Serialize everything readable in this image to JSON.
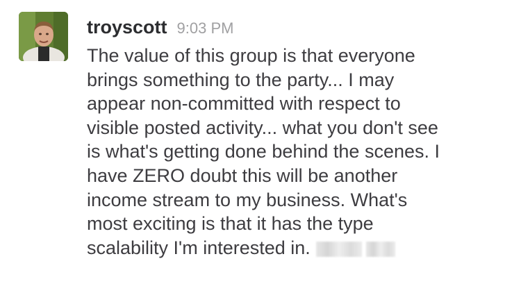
{
  "message": {
    "username": "troyscott",
    "timestamp": "9:03 PM",
    "lines": [
      "The value of this group is that everyone",
      "brings something to the party... I may",
      "appear non-committed with respect to",
      "visible posted activity... what you don't see",
      "is what's getting done behind the scenes. I",
      "have ZERO doubt this will be another",
      "income stream to my business. What's",
      "most exciting is that it has the type",
      "scalability I'm interested in."
    ]
  }
}
